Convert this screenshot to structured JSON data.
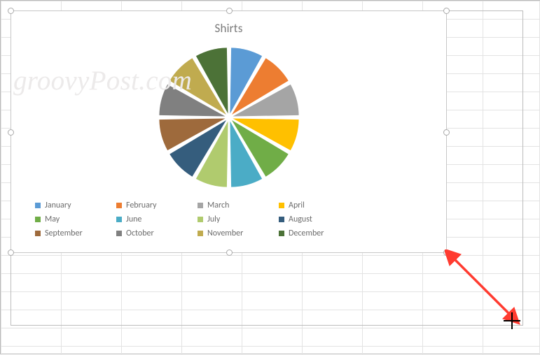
{
  "watermark": "groovyPost.com",
  "chart_data": {
    "type": "pie",
    "title": "Shirts",
    "categories": [
      "January",
      "February",
      "March",
      "April",
      "May",
      "June",
      "July",
      "August",
      "September",
      "October",
      "November",
      "December"
    ],
    "values": [
      1,
      1,
      1,
      1,
      1,
      1,
      1,
      1,
      1,
      1,
      1,
      1
    ],
    "colors": [
      "#5b9bd5",
      "#ed7d31",
      "#a5a5a5",
      "#ffc000",
      "#70ad47",
      "#4bacc6",
      "#b0cb6e",
      "#355d7d",
      "#9e6a3c",
      "#808080",
      "#c0ab4f",
      "#4c7237"
    ],
    "legend_position": "bottom",
    "exploded": true,
    "xlabel": "",
    "ylabel": ""
  },
  "legend": {
    "items": [
      {
        "label": "January"
      },
      {
        "label": "February"
      },
      {
        "label": "March"
      },
      {
        "label": "April"
      },
      {
        "label": "May"
      },
      {
        "label": "June"
      },
      {
        "label": "July"
      },
      {
        "label": "August"
      },
      {
        "label": "September"
      },
      {
        "label": "October"
      },
      {
        "label": "November"
      },
      {
        "label": "December"
      }
    ]
  }
}
